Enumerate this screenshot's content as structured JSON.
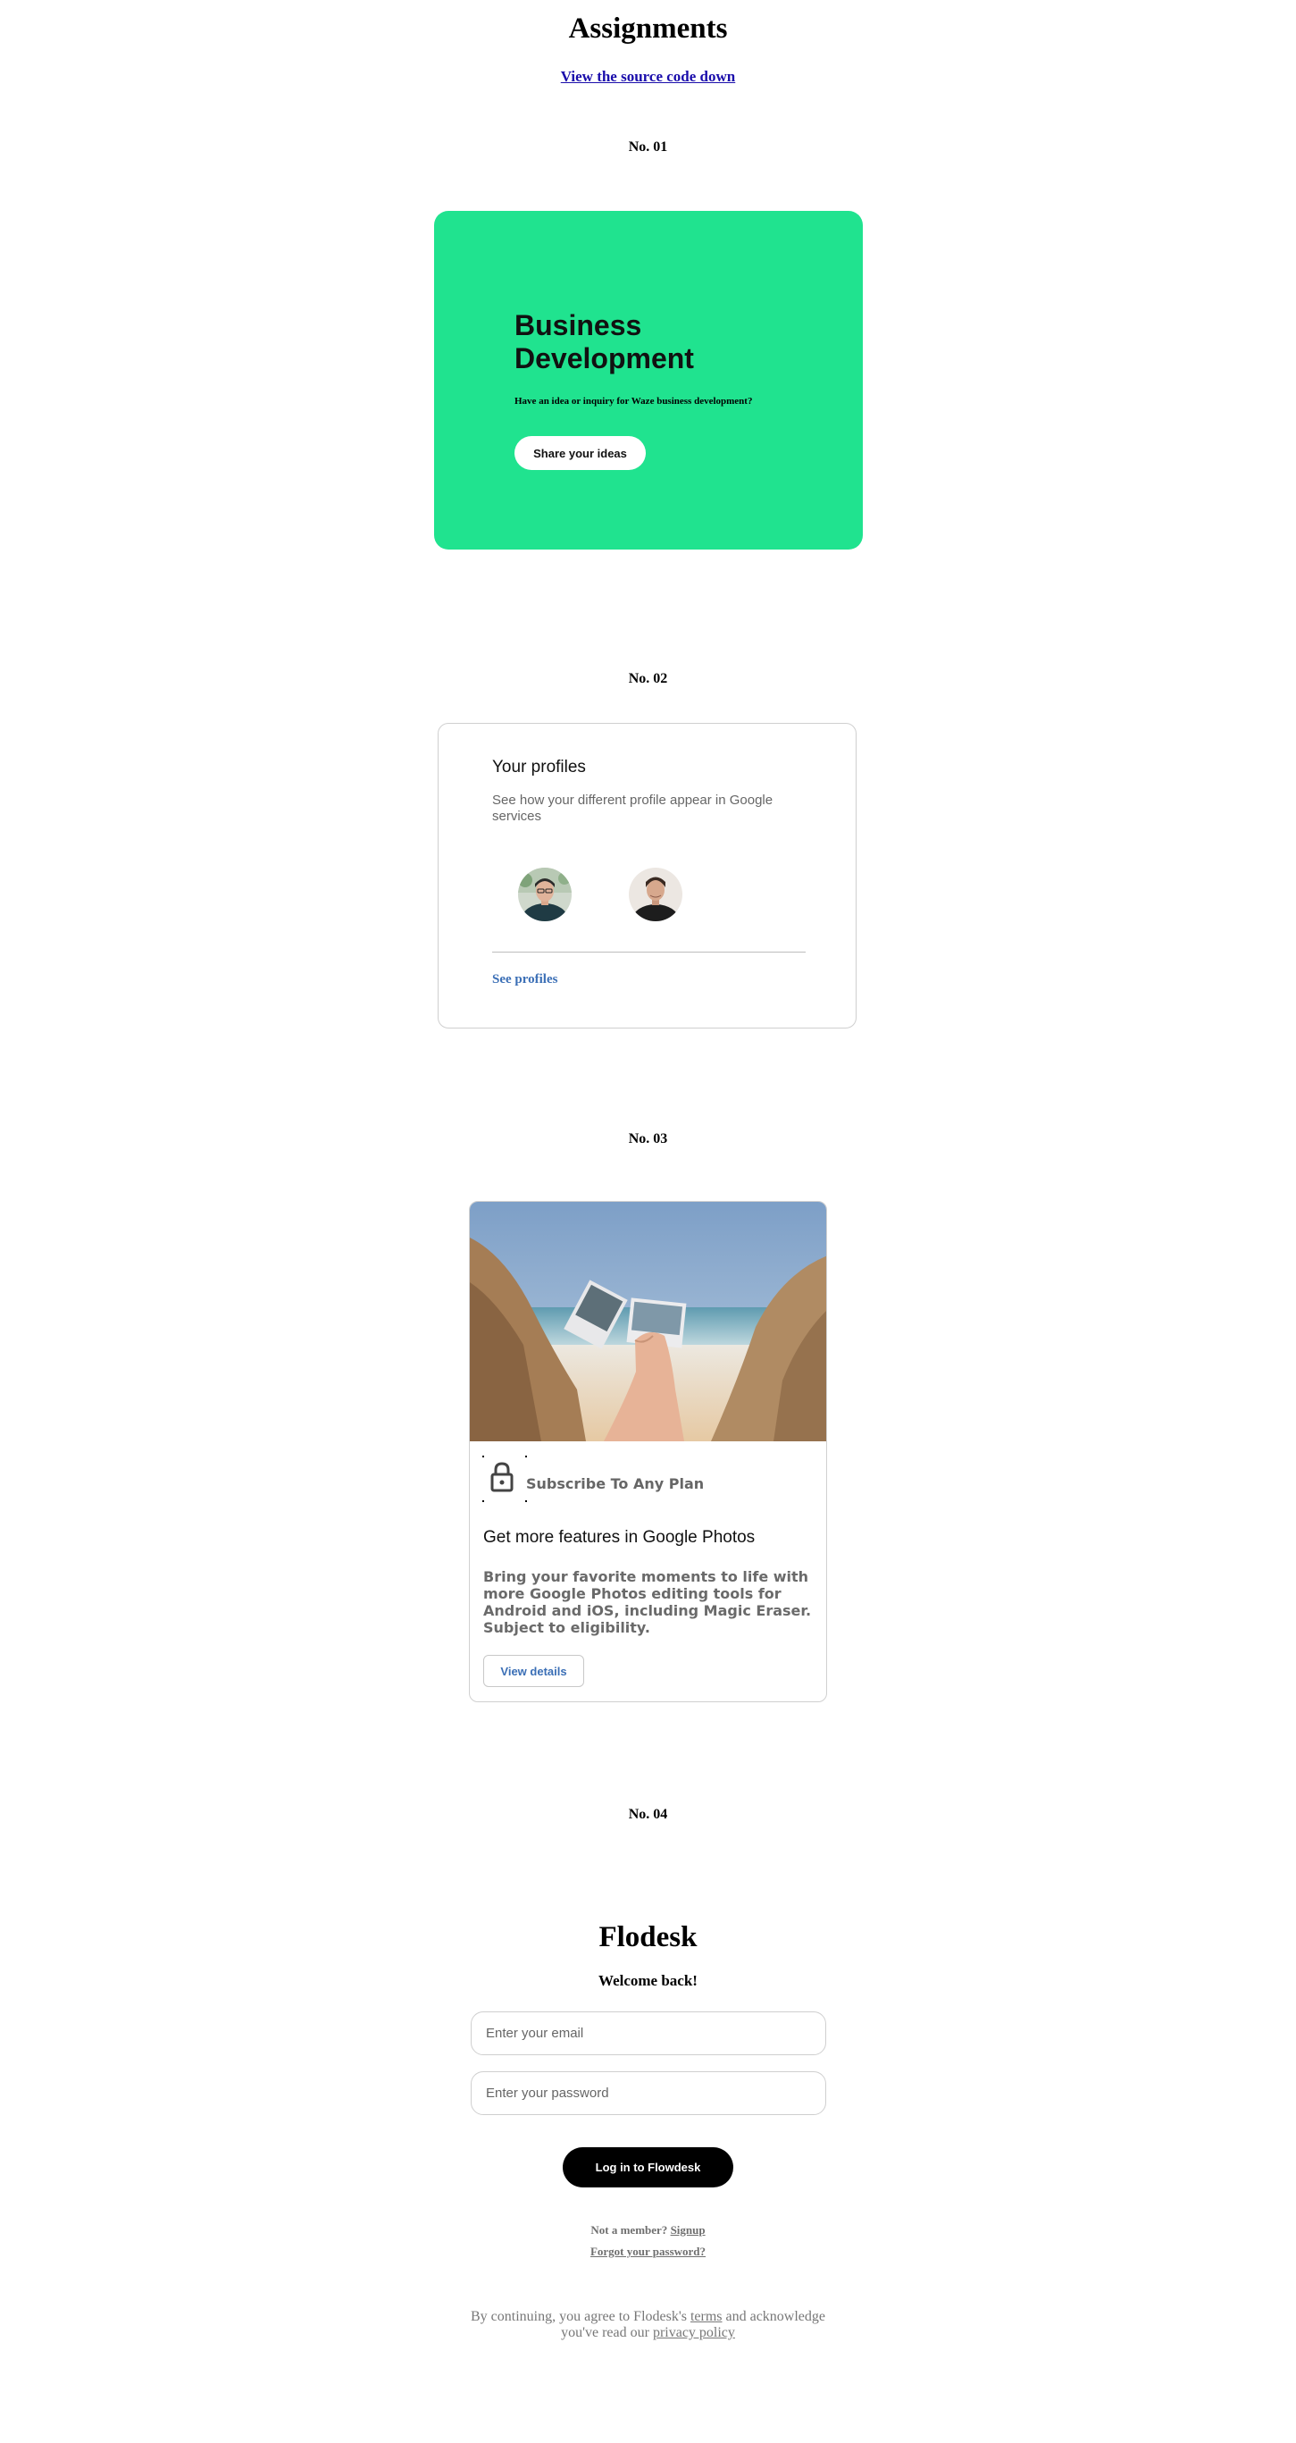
{
  "page": {
    "title": "Assignments",
    "source_link": "View the source code down"
  },
  "sections": {
    "s1": "No. 01",
    "s2": "No. 02",
    "s3": "No. 03",
    "s4": "No. 04"
  },
  "business_card": {
    "title": "Business Development",
    "subtitle": "Have an idea or inquiry for Waze business development?",
    "button_label": "Share your ideas",
    "bg_color": "#20e38f"
  },
  "profiles_card": {
    "title": "Your profiles",
    "description": "See how your different profile appear in Google services",
    "link_label": "See profiles",
    "link_color": "#3b6fb6"
  },
  "photos_card": {
    "subscribe_label": "Subscribe To Any Plan",
    "title": "Get more features in Google Photos",
    "description": "Bring your favorite moments to life with more Google Photos editing tools for Android and iOS, including Magic Eraser. Subject to eligibility.",
    "button_label": "View details"
  },
  "flodesk": {
    "brand": "Flodesk",
    "welcome": "Welcome back!",
    "email_placeholder": "Enter your email",
    "password_placeholder": "Enter your password",
    "login_label": "Log in to Flowdesk",
    "member_prefix": "Not a member?",
    "signup_label": "Signup",
    "forgot_label": "Forgot your password?",
    "legal_prefix": "By continuing, you agree to Flodesk's",
    "terms_label": "terms",
    "legal_middle": "and acknowledge you've read our",
    "privacy_label": "privacy policy"
  }
}
